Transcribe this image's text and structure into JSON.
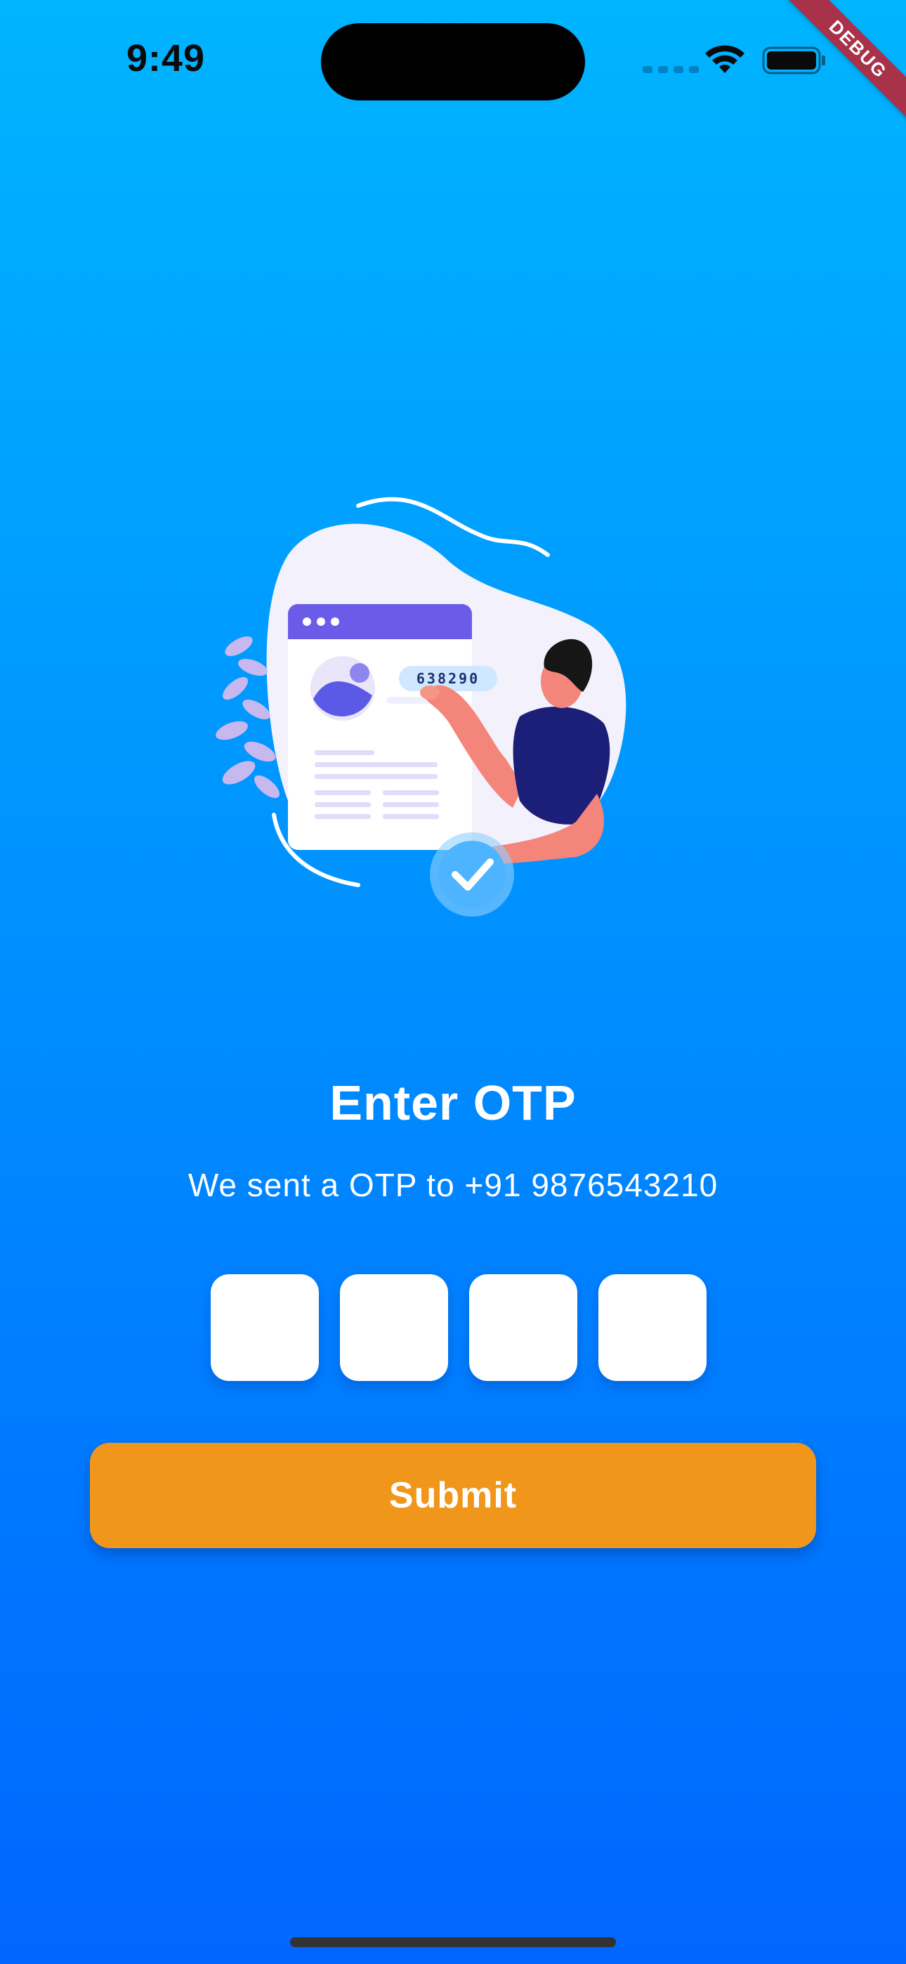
{
  "status_bar": {
    "time": "9:49"
  },
  "debug_ribbon": "DEBUG",
  "illustration": {
    "code_text": "638290"
  },
  "otp": {
    "title": "Enter OTP",
    "subtitle": "We sent a OTP to +91 9876543210",
    "digits": [
      "",
      "",
      "",
      ""
    ]
  },
  "submit_label": "Submit",
  "colors": {
    "background_top": "#00b4ff",
    "background_bottom": "#0066ff",
    "submit_button": "#f0961a",
    "otp_box": "#ffffff"
  }
}
